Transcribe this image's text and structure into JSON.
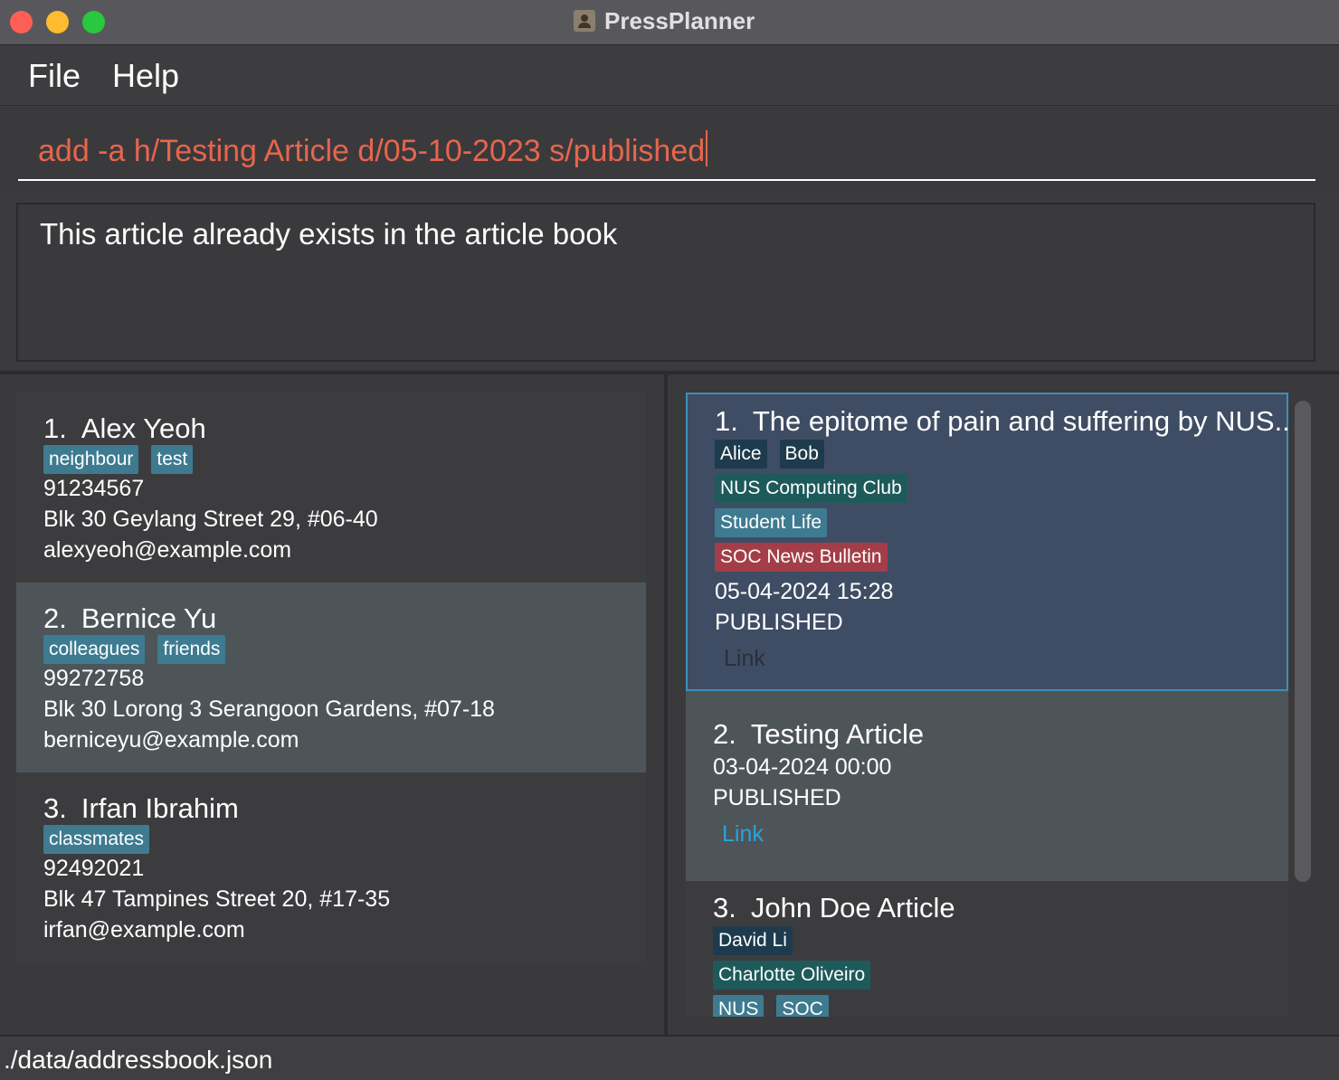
{
  "window": {
    "title": "PressPlanner"
  },
  "menu": {
    "file": "File",
    "help": "Help"
  },
  "command": {
    "value": "add -a h/Testing Article d/05-10-2023 s/published"
  },
  "result": {
    "message": "This article already exists in the article book"
  },
  "persons": [
    {
      "index": "1.",
      "name": "Alex Yeoh",
      "tags": [
        "neighbour",
        "test"
      ],
      "phone": "91234567",
      "address": "Blk 30 Geylang Street 29, #06-40",
      "email": "alexyeoh@example.com"
    },
    {
      "index": "2.",
      "name": "Bernice Yu",
      "tags": [
        "colleagues",
        "friends"
      ],
      "phone": "99272758",
      "address": "Blk 30 Lorong 3 Serangoon Gardens, #07-18",
      "email": "berniceyu@example.com"
    },
    {
      "index": "3.",
      "name": "Irfan Ibrahim",
      "tags": [
        "classmates"
      ],
      "phone": "92492021",
      "address": "Blk 47 Tampines Street 20, #17-35",
      "email": "irfan@example.com"
    }
  ],
  "articles": [
    {
      "index": "1.",
      "title": "The epitome of pain and suffering by NUS...",
      "authors": [
        "Alice",
        "Bob"
      ],
      "sources": [
        "NUS Computing Club"
      ],
      "tags": [
        "Student Life"
      ],
      "outlets": [
        "SOC News Bulletin"
      ],
      "date": "05-04-2024 15:28",
      "status": "PUBLISHED",
      "link": "Link"
    },
    {
      "index": "2.",
      "title": "Testing Article",
      "date": "03-04-2024 00:00",
      "status": "PUBLISHED",
      "link": "Link"
    },
    {
      "index": "3.",
      "title": "John Doe Article",
      "authors": [
        "David Li"
      ],
      "sources": [
        "Charlotte Oliveiro"
      ],
      "tags": [
        "NUS",
        "SOC"
      ]
    }
  ],
  "status": {
    "path": "./data/addressbook.json"
  },
  "colors": {
    "command_text": "#e8654d",
    "tag_blue": "#3e7b91",
    "tag_navy": "#1d3b4d",
    "tag_teal": "#1e5a5a",
    "tag_red": "#a33e48",
    "selected_border": "#3d8eb9",
    "link_blue": "#29a3dc"
  }
}
